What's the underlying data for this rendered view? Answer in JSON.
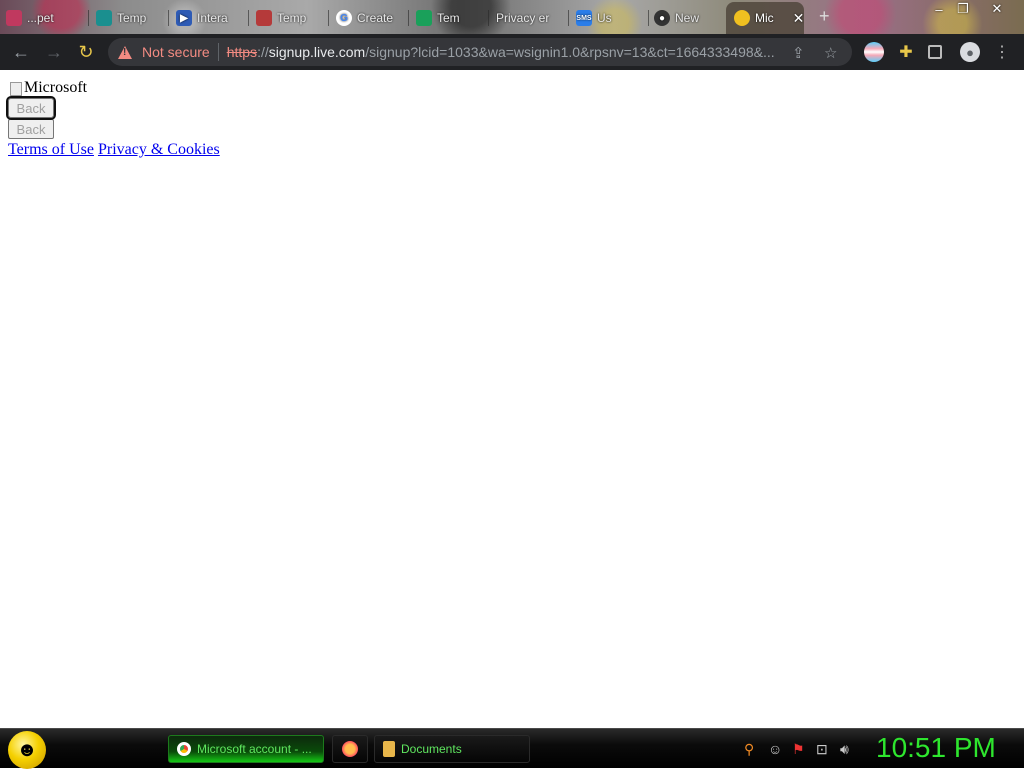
{
  "browser": {
    "tabs": [
      {
        "label": "...pet",
        "icon": "generic-tab-icon",
        "color": "#c0395f"
      },
      {
        "label": "Temp",
        "icon": "temp-icon",
        "color": "#1a8f8f"
      },
      {
        "label": "Intera",
        "icon": "play-icon",
        "color": "#2e5bb5"
      },
      {
        "label": "Temp",
        "icon": "temp-icon",
        "color": "#b53a3a"
      },
      {
        "label": "Create",
        "icon": "google-icon",
        "color": "#ffffff"
      },
      {
        "label": "Tem",
        "icon": "temp-icon",
        "color": "#1aa05a"
      },
      {
        "label": "Privacy er",
        "icon": "privacy-icon",
        "color": "#777777"
      },
      {
        "label": "SMS",
        "icon": "sms-icon",
        "color": "#2b7de9"
      },
      {
        "label": "Us",
        "icon": "us-icon",
        "color": "#444444"
      },
      {
        "label": "New",
        "icon": "github-icon",
        "color": "#333333"
      }
    ],
    "active_tab": {
      "label": "Mic",
      "icon": "microsoft-icon",
      "color": "#f0c020"
    },
    "close_glyph": "✕",
    "new_tab_glyph": "+",
    "security_label": "Not secure",
    "url": {
      "scheme": "https",
      "separator": "://",
      "host": "signup.live.com",
      "rest": "/signup?lcid=1033&wa=wsignin1.0&rpsnv=13&ct=1664333498&..."
    }
  },
  "page": {
    "logo_alt": "Microsoft",
    "back_buttons": [
      "Back",
      "Back"
    ],
    "links": [
      "Terms of Use",
      "Privacy & Cookies"
    ]
  },
  "taskbar": {
    "items": [
      {
        "label": "Microsoft account - ...",
        "icon": "chrome-icon",
        "active": true
      },
      {
        "label": "",
        "icon": "firefox-icon",
        "active": false
      },
      {
        "label": "Documents",
        "icon": "folder-icon",
        "active": false
      }
    ],
    "clock": "10:51 PM"
  },
  "colors": {
    "not_secure": "#f28b82",
    "link": "#0000ee",
    "clock": "#2ee62e",
    "taskbar_text": "#5fe65f"
  }
}
